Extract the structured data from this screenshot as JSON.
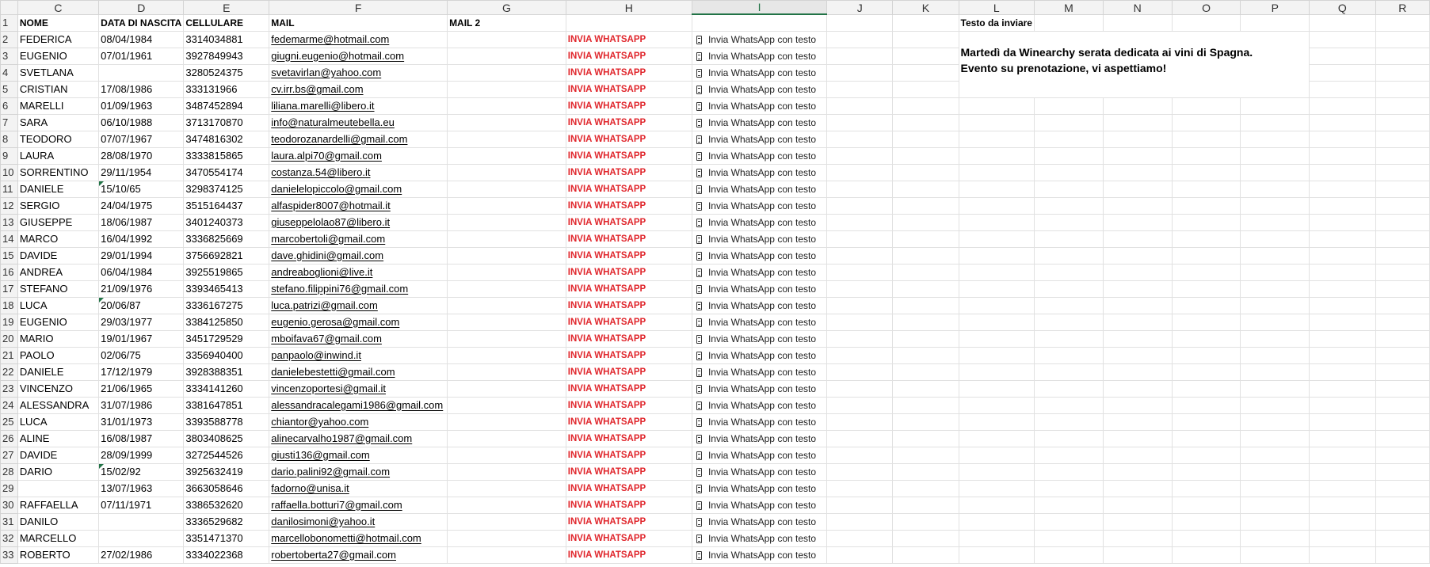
{
  "columns": [
    "C",
    "D",
    "E",
    "F",
    "G",
    "H",
    "I",
    "J",
    "K",
    "L",
    "M",
    "N",
    "O",
    "P",
    "Q",
    "R"
  ],
  "selected_column": "I",
  "header": {
    "row": "1",
    "nome": "NOME",
    "data": "DATA DI NASCITA",
    "cell": "CELLULARE",
    "mail": "MAIL",
    "mail2": "MAIL 2",
    "testo": "Testo da inviare"
  },
  "message": {
    "line1": "Martedì  da Winearchy  serata dedicata ai vini di Spagna.",
    "line2": "Evento su prenotazione, vi aspettiamo!"
  },
  "action_label": "INVIA WHATSAPP",
  "action_text_label": "Invia WhatsApp con testo",
  "rows": [
    {
      "n": "2",
      "nome": "FEDERICA",
      "data": "08/04/1984",
      "cell": "3314034881",
      "mail": "fedemarme@hotmail.com"
    },
    {
      "n": "3",
      "nome": "EUGENIO",
      "data": "07/01/1961",
      "cell": "3927849943",
      "mail": "giugni.eugenio@hotmail.com"
    },
    {
      "n": "4",
      "nome": "SVETLANA",
      "data": "",
      "cell": "3280524375",
      "mail": "svetavirlan@yahoo.com"
    },
    {
      "n": "5",
      "nome": "CRISTIAN",
      "data": "17/08/1986",
      "cell": "333131966",
      "mail": "cv.irr.bs@gmail.com"
    },
    {
      "n": "6",
      "nome": "MARELLI",
      "data": "01/09/1963",
      "cell": "3487452894",
      "mail": "liliana.marelli@libero.it"
    },
    {
      "n": "7",
      "nome": "SARA",
      "data": "06/10/1988",
      "cell": "3713170870",
      "mail": "info@naturalmeutebella.eu"
    },
    {
      "n": "8",
      "nome": "TEODORO",
      "data": "07/07/1967",
      "cell": "3474816302",
      "mail": "teodorozanardelli@gmail.com"
    },
    {
      "n": "9",
      "nome": "LAURA",
      "data": "28/08/1970",
      "cell": "3333815865",
      "mail": "laura.alpi70@gmail.com"
    },
    {
      "n": "10",
      "nome": "SORRENTINO",
      "data": "29/11/1954",
      "cell": "3470554174",
      "mail": "costanza.54@libero.it"
    },
    {
      "n": "11",
      "nome": "DANIELE",
      "data": "15/10/65",
      "cell": "3298374125",
      "mail": "danielelopiccolo@gmail.com",
      "tri": true
    },
    {
      "n": "12",
      "nome": "SERGIO",
      "data": "24/04/1975",
      "cell": "3515164437",
      "mail": "alfaspider8007@hotmail.it"
    },
    {
      "n": "13",
      "nome": "GIUSEPPE",
      "data": "18/06/1987",
      "cell": "3401240373",
      "mail": "giuseppelolao87@libero.it"
    },
    {
      "n": "14",
      "nome": "MARCO",
      "data": "16/04/1992",
      "cell": "3336825669",
      "mail": "marcobertoli@gmail.com"
    },
    {
      "n": "15",
      "nome": "DAVIDE",
      "data": "29/01/1994",
      "cell": "3756692821",
      "mail": "dave.ghidini@gmail.com"
    },
    {
      "n": "16",
      "nome": "ANDREA",
      "data": "06/04/1984",
      "cell": "3925519865",
      "mail": "andreaboglioni@live.it"
    },
    {
      "n": "17",
      "nome": "STEFANO",
      "data": "21/09/1976",
      "cell": "3393465413",
      "mail": "stefano.filippini76@gmail.com"
    },
    {
      "n": "18",
      "nome": "LUCA",
      "data": "20/06/87",
      "cell": "3336167275",
      "mail": "luca.patrizi@gmail.com",
      "tri": true
    },
    {
      "n": "19",
      "nome": "EUGENIO",
      "data": "29/03/1977",
      "cell": "3384125850",
      "mail": "eugenio.gerosa@gmail.com"
    },
    {
      "n": "20",
      "nome": "MARIO",
      "data": "19/01/1967",
      "cell": "3451729529",
      "mail": "mboifava67@gmail.com"
    },
    {
      "n": "21",
      "nome": "PAOLO",
      "data": "02/06/75",
      "cell": "3356940400",
      "mail": "panpaolo@inwind.it"
    },
    {
      "n": "22",
      "nome": "DANIELE",
      "data": "17/12/1979",
      "cell": "3928388351",
      "mail": "danielebestetti@gmail.com"
    },
    {
      "n": "23",
      "nome": "VINCENZO",
      "data": "21/06/1965",
      "cell": "3334141260",
      "mail": "vincenzoportesi@gmail.it"
    },
    {
      "n": "24",
      "nome": "ALESSANDRA",
      "data": "31/07/1986",
      "cell": "3381647851",
      "mail": "alessandracalegami1986@gmail.com"
    },
    {
      "n": "25",
      "nome": "LUCA",
      "data": "31/01/1973",
      "cell": "3393588778",
      "mail": "chiantor@yahoo.com"
    },
    {
      "n": "26",
      "nome": "ALINE",
      "data": "16/08/1987",
      "cell": "3803408625",
      "mail": "alinecarvalho1987@gmail.com"
    },
    {
      "n": "27",
      "nome": "DAVIDE",
      "data": "28/09/1999",
      "cell": "3272544526",
      "mail": "giusti136@gmail.com"
    },
    {
      "n": "28",
      "nome": "DARIO",
      "data": "15/02/92",
      "cell": "3925632419",
      "mail": "dario.palini92@gmail.com",
      "tri": true
    },
    {
      "n": "29",
      "nome": "",
      "data": "13/07/1963",
      "cell": "3663058646",
      "mail": "fadorno@unisa.it"
    },
    {
      "n": "30",
      "nome": "RAFFAELLA",
      "data": "07/11/1971",
      "cell": "3386532620",
      "mail": "raffaella.botturi7@gmail.com"
    },
    {
      "n": "31",
      "nome": "DANILO",
      "data": "",
      "cell": "3336529682",
      "mail": "danilosimoni@yahoo.it"
    },
    {
      "n": "32",
      "nome": "MARCELLO",
      "data": "",
      "cell": "3351471370",
      "mail": "marcellobonometti@hotmail.com"
    },
    {
      "n": "33",
      "nome": "ROBERTO",
      "data": "27/02/1986",
      "cell": "3334022368",
      "mail": "robertoberta27@gmail.com"
    }
  ]
}
